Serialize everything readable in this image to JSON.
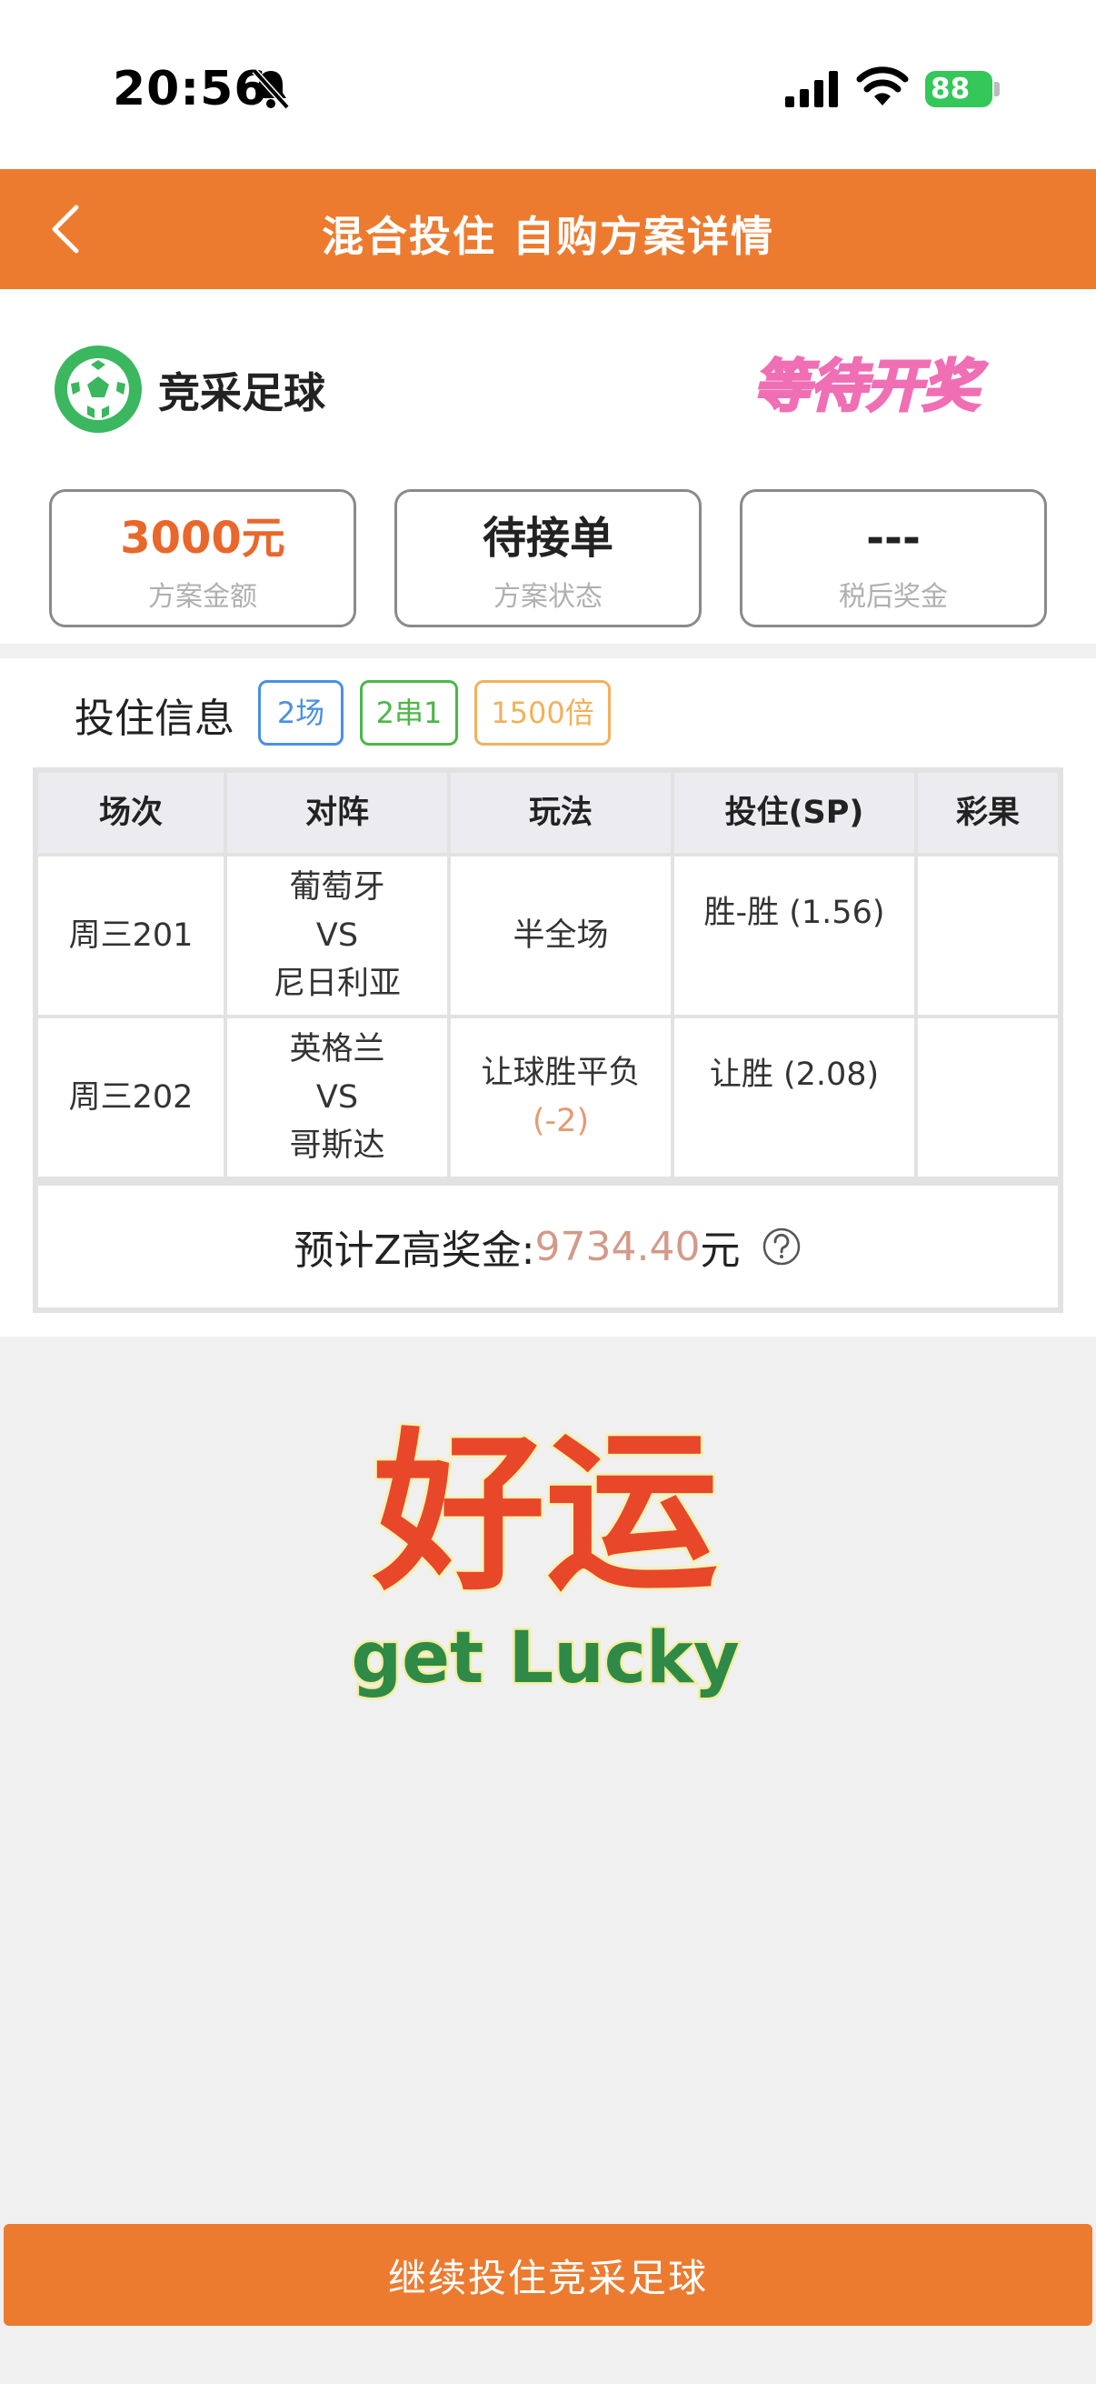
{
  "status_bar": {
    "time": "20:56",
    "battery": "88"
  },
  "nav": {
    "title": "混合投住 自购方案详情"
  },
  "header": {
    "lottery_name": "竞采足球",
    "stamp_text": "等待开奖",
    "colors": {
      "brand": "#ec7b30",
      "amount": "#e9672b",
      "stamp": "#f06fb4"
    }
  },
  "summary": [
    {
      "value": "3000元",
      "label": "方案金额"
    },
    {
      "value": "待接单",
      "label": "方案状态"
    },
    {
      "value": "---",
      "label": "税后奖金"
    }
  ],
  "bet_info": {
    "title": "投住信息",
    "tags": [
      "2场",
      "2串1",
      "1500倍"
    ],
    "columns": [
      "场次",
      "对阵",
      "玩法",
      "投住(SP)",
      "彩果"
    ],
    "rows": [
      {
        "match": "周三201",
        "home": "葡萄牙",
        "vs": "VS",
        "away": "尼日利亚",
        "play": "半全场",
        "handicap": "",
        "bet": "胜-胜 (1.56)",
        "result": ""
      },
      {
        "match": "周三202",
        "home": "英格兰",
        "vs": "VS",
        "away": "哥斯达",
        "play": "让球胜平负",
        "handicap": "(-2)",
        "bet": "让胜 (2.08)",
        "result": ""
      }
    ],
    "prize": {
      "label": "预计Z高奖金:",
      "value": "9734.40",
      "unit": "元"
    }
  },
  "lucky": {
    "title": "好运",
    "subtitle": "get Lucky"
  },
  "bottom_button": {
    "label": "继续投住竞采足球"
  }
}
